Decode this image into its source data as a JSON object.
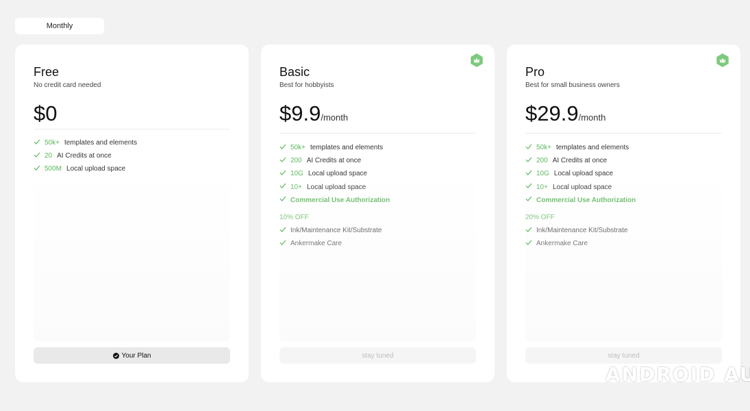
{
  "billing": {
    "period_label": "Monthly"
  },
  "plans": [
    {
      "name": "Free",
      "subtitle": "No credit card needed",
      "price": "$0",
      "per": "",
      "features": [
        {
          "highlight": "50k+",
          "text": "templates and elements"
        },
        {
          "highlight": "20",
          "text": "AI Credits at once"
        },
        {
          "highlight": "500M",
          "text": "Local upload space"
        }
      ],
      "button_label": "Your Plan"
    },
    {
      "name": "Basic",
      "subtitle": "Best for hobbyists",
      "price": "$9.9",
      "per": "/month",
      "features": [
        {
          "highlight": "50k+",
          "text": "templates and elements"
        },
        {
          "highlight": "200",
          "text": "AI Credits at once"
        },
        {
          "highlight": "10G",
          "text": "Local upload space"
        },
        {
          "highlight": "10+",
          "text": "Local upload space"
        },
        {
          "highlight": "",
          "text": "Commercial Use Authorization"
        }
      ],
      "discount_label": "10% OFF",
      "extras": [
        "Ink/Maintenance Kit/Substrate",
        "Ankermake Care"
      ],
      "button_label": "stay tuned"
    },
    {
      "name": "Pro",
      "subtitle": "Best for small business owners",
      "price": "$29.9",
      "per": "/month",
      "features": [
        {
          "highlight": "50k+",
          "text": "templates and elements"
        },
        {
          "highlight": "200",
          "text": "AI Credits at once"
        },
        {
          "highlight": "10G",
          "text": "Local upload space"
        },
        {
          "highlight": "10+",
          "text": "Local upload space"
        },
        {
          "highlight": "",
          "text": "Commercial Use Authorization"
        }
      ],
      "discount_label": "20% OFF",
      "extras": [
        "Ink/Maintenance Kit/Substrate",
        "Ankermake Care"
      ],
      "button_label": "stay tuned"
    }
  ],
  "watermark": "ANDROID AUTHORITY",
  "colors": {
    "accent": "#5cb65c",
    "background": "#f2f2f2",
    "card": "#ffffff"
  }
}
